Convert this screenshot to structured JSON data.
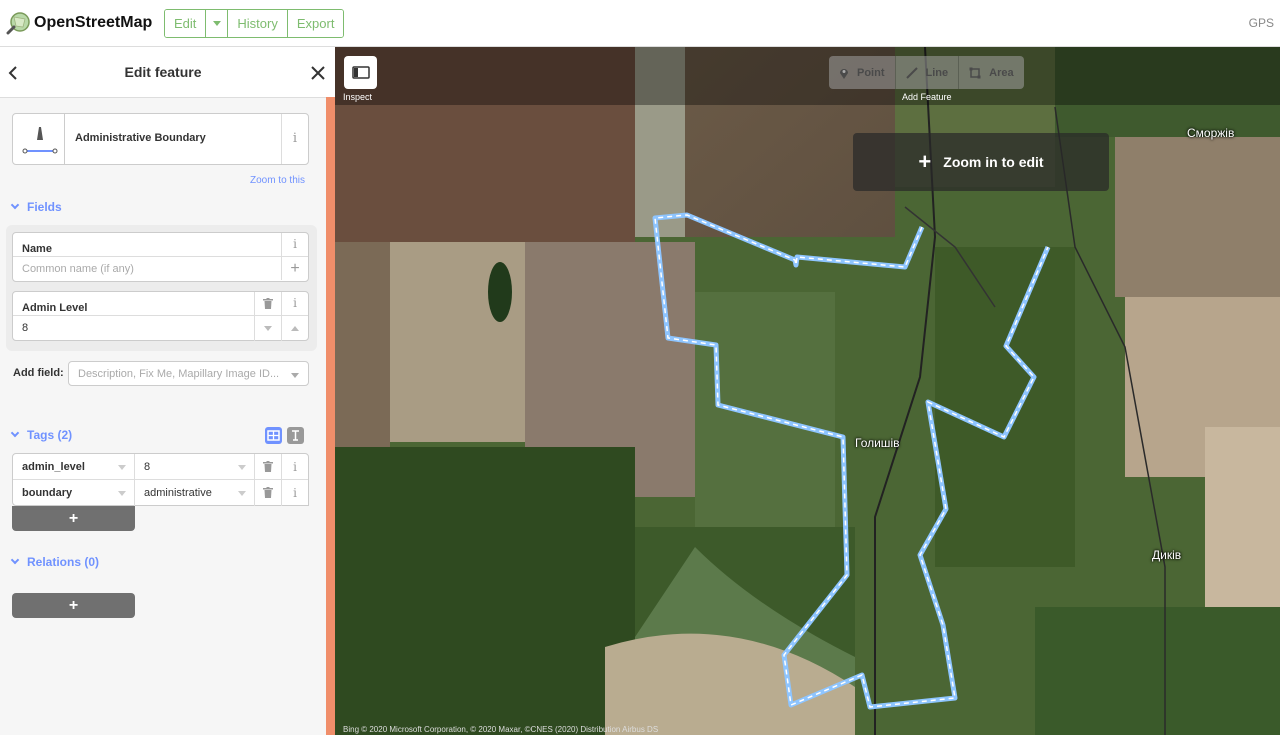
{
  "app": {
    "brand": "OpenStreetMap",
    "nav": [
      "Edit",
      "History",
      "Export"
    ],
    "gps": "GPS"
  },
  "sidebar": {
    "title": "Edit feature",
    "preset": {
      "name": "Administrative Boundary",
      "zoom_link": "Zoom to this"
    },
    "fields": {
      "heading": "Fields",
      "name": {
        "label": "Name",
        "placeholder": "Common name (if any)"
      },
      "admin_level": {
        "label": "Admin Level",
        "value": "8"
      },
      "add_field_label": "Add field:",
      "add_field_placeholder": "Description, Fix Me, Mapillary Image ID..."
    },
    "tags": {
      "heading": "Tags (2)",
      "rows": [
        {
          "key": "admin_level",
          "value": "8"
        },
        {
          "key": "boundary",
          "value": "administrative"
        }
      ],
      "add": "+"
    },
    "relations": {
      "heading": "Relations (0)",
      "add": "+"
    }
  },
  "map": {
    "inspect_label": "Inspect",
    "modes": [
      "Point",
      "Line",
      "Area"
    ],
    "add_feature_label": "Add Feature",
    "zoom_in_to_edit": "Zoom in to edit",
    "places": [
      "Сморжів",
      "Голишів",
      "Диків"
    ],
    "attribution": "Bing © 2020 Microsoft Corporation, © 2020 Maxar, ©CNES (2020) Distribution Airbus DS"
  },
  "colors": {
    "accent": "#7092ff",
    "osm_green": "#7ebc6f",
    "scrollbar": "#f08e6a",
    "boundary": "#8ec5ff"
  }
}
